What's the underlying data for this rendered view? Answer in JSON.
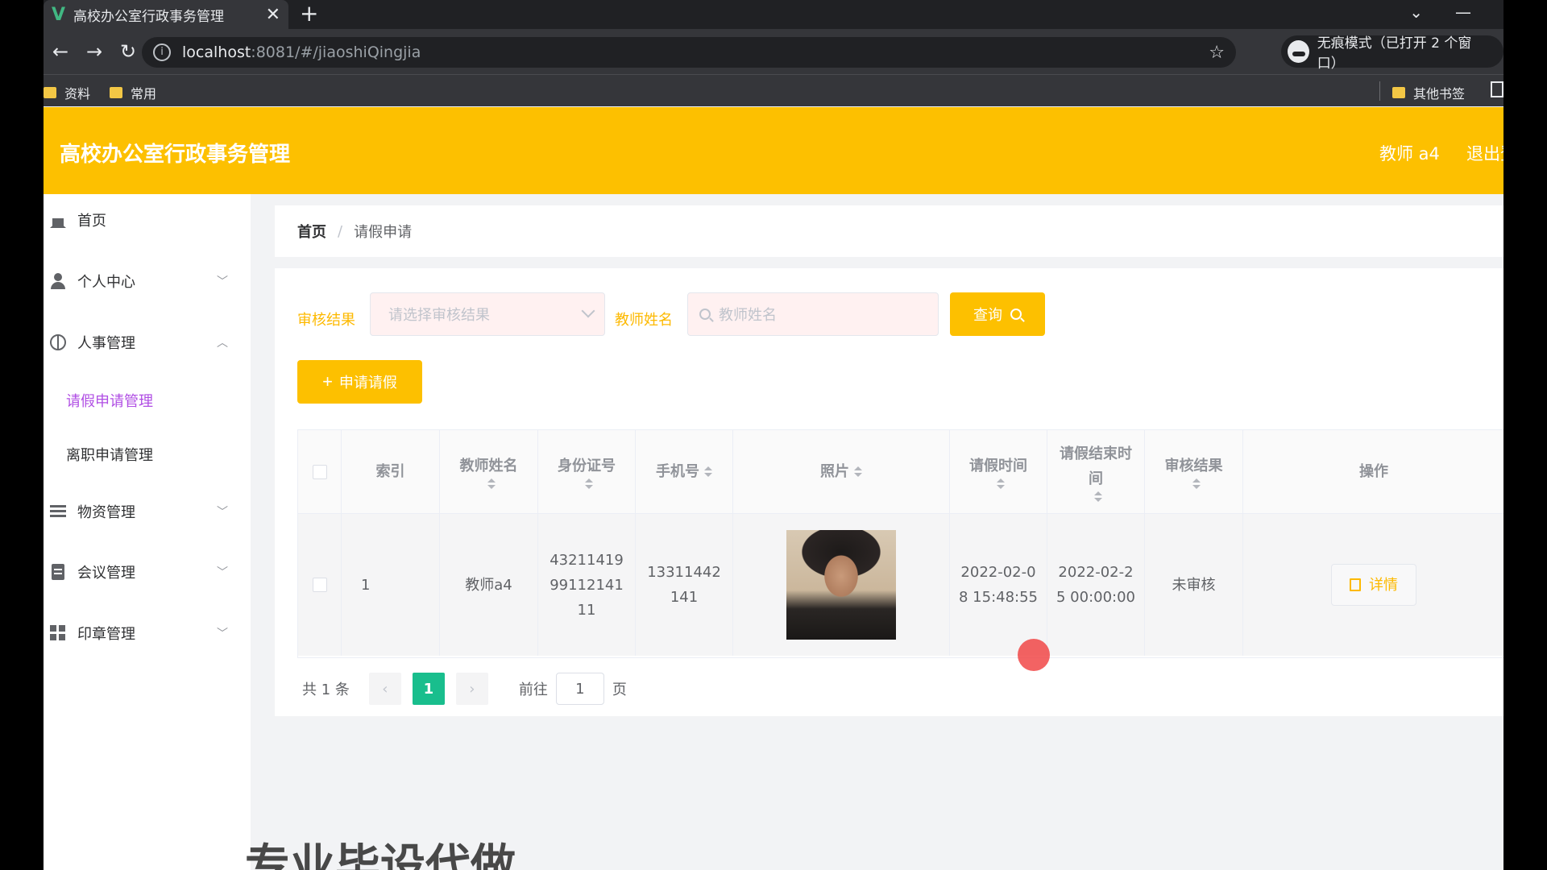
{
  "browser": {
    "tab_title": "高校办公室行政事务管理",
    "tab_logo": "V",
    "close_glyph": "✕",
    "new_tab_glyph": "+",
    "url_host": "localhost",
    "url_path": ":8081/#/jiaoshiQingjia",
    "incognito_label": "无痕模式（已打开 2 个窗口）",
    "bookmarks": [
      "资料",
      "常用"
    ],
    "other_bookmarks": "其他书签"
  },
  "header": {
    "title": "高校办公室行政事务管理",
    "user": "教师 a4",
    "logout": "退出登录"
  },
  "sidebar": {
    "items": [
      {
        "label": "首页",
        "icon": "home-icon"
      },
      {
        "label": "个人中心",
        "icon": "user-icon"
      },
      {
        "label": "人事管理",
        "icon": "globe-icon"
      },
      {
        "label": "物资管理",
        "icon": "list-icon"
      },
      {
        "label": "会议管理",
        "icon": "clipboard-icon"
      },
      {
        "label": "印章管理",
        "icon": "grid-icon"
      }
    ],
    "subitems": [
      {
        "label": "请假申请管理",
        "active": true
      },
      {
        "label": "离职申请管理",
        "active": false
      }
    ]
  },
  "breadcrumb": {
    "home": "首页",
    "separator": "/",
    "current": "请假申请"
  },
  "filters": {
    "status_label": "审核结果",
    "status_placeholder": "请选择审核结果",
    "name_label": "教师姓名",
    "name_placeholder": "教师姓名",
    "query_button": "查询",
    "add_button": "申请请假"
  },
  "table": {
    "headers": [
      "索引",
      "教师姓名",
      "身份证号",
      "手机号",
      "照片",
      "请假时间",
      "请假结束时间",
      "审核结果",
      "操作"
    ],
    "rows": [
      {
        "index": "1",
        "name": "教师a4",
        "id_card": "432114199911214111",
        "phone": "13311442141",
        "leave_time": "2022-02-08 15:48:55",
        "end_time": "2022-02-25 00:00:00",
        "status": "未审核",
        "action": "详情"
      }
    ]
  },
  "pagination": {
    "total": "共 1 条",
    "current": "1",
    "goto_label": "前往",
    "goto_value": "1",
    "page_suffix": "页"
  },
  "overlay_text": "专业毕设代做",
  "colors": {
    "accent": "#fdc000",
    "active_menu": "#b04ee4",
    "page_active": "#19be8d"
  }
}
